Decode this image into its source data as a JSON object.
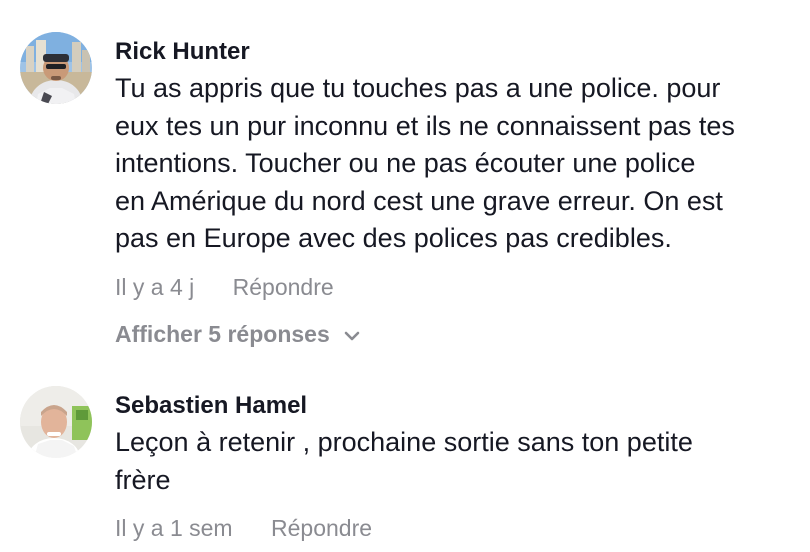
{
  "comments": [
    {
      "username": "Rick Hunter",
      "text_lines": [
        "Tu as appris que tu touches pas a une police. pour",
        "eux tes un pur inconnu et ils ne connaissent pas tes",
        "intentions. Toucher ou ne pas écouter une police",
        "en Amérique du nord cest une grave erreur. On est",
        "pas en Europe avec des polices pas credibles."
      ],
      "time": "Il y a 4 j",
      "reply_label": "Répondre",
      "view_replies_label": "Afficher 5 réponses",
      "avatar_icon": "user-photo-avatar"
    },
    {
      "username": "Sebastien Hamel",
      "text_lines": [
        "Leçon à retenir , prochaine sortie sans ton petite",
        "frère"
      ],
      "time": "Il y a 1 sem",
      "reply_label": "Répondre",
      "avatar_icon": "user-photo-avatar"
    }
  ],
  "colors": {
    "text": "#161823",
    "muted": "#8a8b91",
    "background": "#ffffff"
  }
}
